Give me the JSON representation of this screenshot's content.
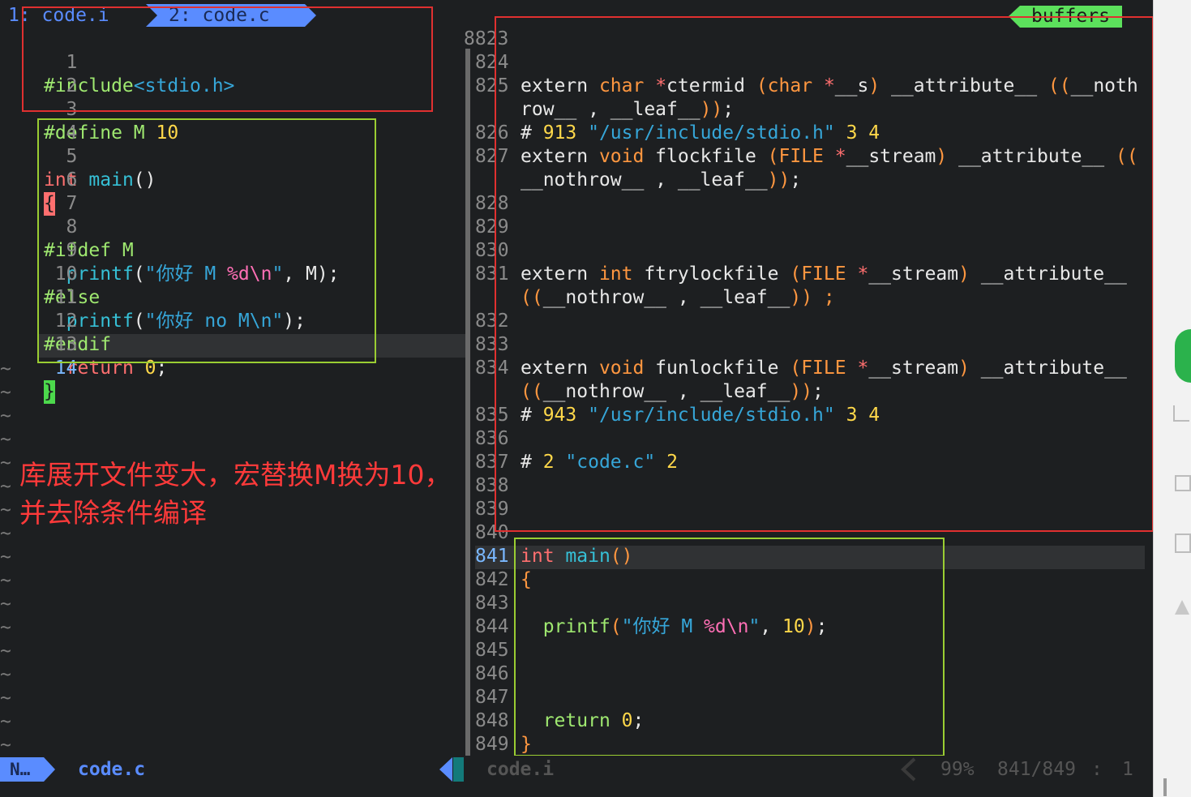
{
  "tabs": {
    "tab1_label": "1: code.i",
    "tab2_label": "2: code.c",
    "buffers_label": "buffers"
  },
  "left_pane": {
    "lines": [
      {
        "no": "1",
        "text": "#include<stdio.h>"
      },
      {
        "no": "2",
        "text": ""
      },
      {
        "no": "3",
        "text": "#define M 10"
      },
      {
        "no": "4",
        "text": ""
      },
      {
        "no": "5",
        "text": "int main()"
      },
      {
        "no": "6",
        "text": "{"
      },
      {
        "no": "7",
        "text": ""
      },
      {
        "no": "8",
        "text": "#ifdef M"
      },
      {
        "no": "9",
        "text": "  printf(\"你好 M %d\\n\", M);"
      },
      {
        "no": "10",
        "text": "#else"
      },
      {
        "no": "11",
        "text": "  printf(\"你好 no M\\n\");"
      },
      {
        "no": "12",
        "text": "#endif"
      },
      {
        "no": "13",
        "text": "  return 0;"
      },
      {
        "no": "14",
        "text": "}"
      }
    ],
    "tilde": "~"
  },
  "annotation": {
    "line1": "库展开文件变大，宏替换M换为10，",
    "line2": "并去除条件编译"
  },
  "right_pane": {
    "line_numbers": [
      "8823",
      "824",
      "825",
      "",
      "826",
      "827",
      "",
      "828",
      "829",
      "830",
      "831",
      "",
      "832",
      "833",
      "834",
      "",
      "835",
      "836",
      "837",
      "838",
      "839",
      "840",
      "841",
      "842",
      "843",
      "844",
      "845",
      "846",
      "847",
      "848",
      "849"
    ]
  },
  "statusline": {
    "mode": "N…",
    "left_file": "code.c",
    "right_file": "code.i",
    "percent": "99%",
    "position": "841/849",
    "sep": ":",
    "column": "1"
  },
  "colors": {
    "background": "#1d1f21",
    "red_box": "#e03030",
    "green_box": "#9acd32",
    "tab_active": "#5a8cff",
    "buffers_tag": "#5ce05c",
    "annotation": "#ff3a3a"
  }
}
